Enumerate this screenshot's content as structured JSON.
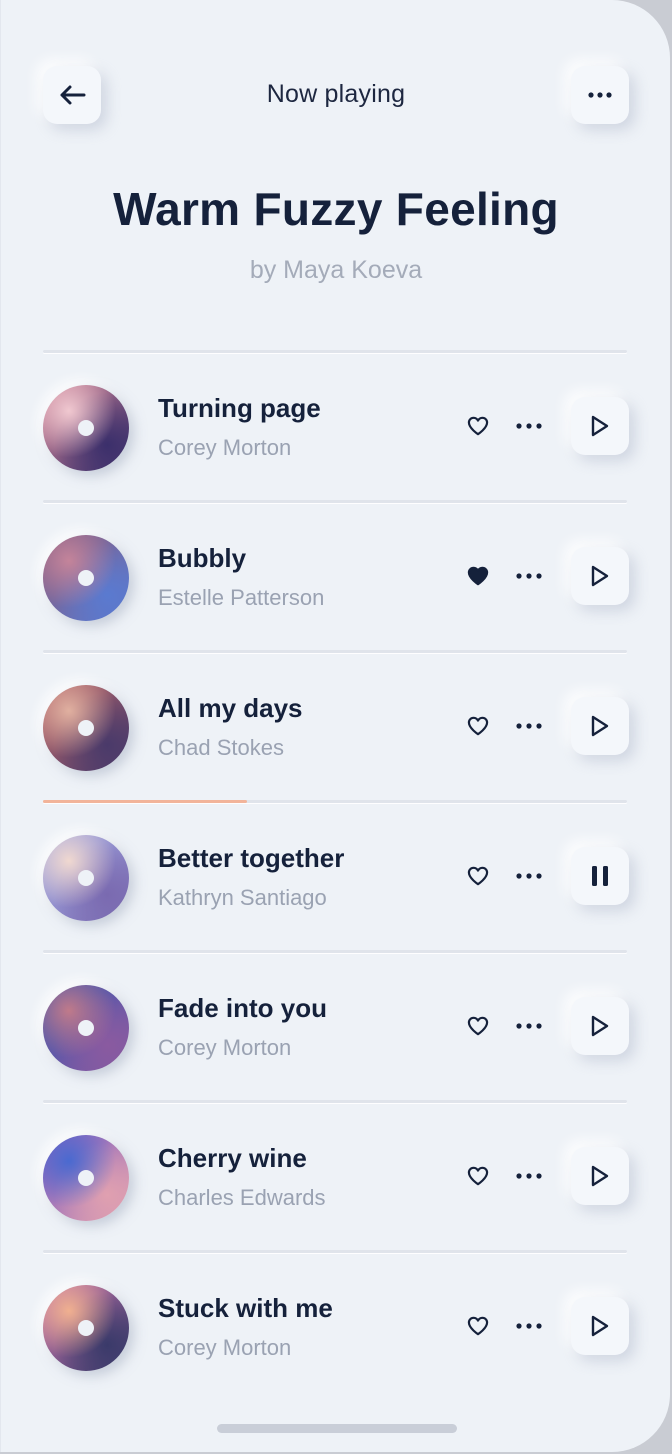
{
  "header": {
    "title": "Now playing",
    "back_icon": "arrow-left-icon",
    "more_icon": "ellipsis-icon"
  },
  "album": {
    "title": "Warm Fuzzy Feeling",
    "artist": "by Maya Koeva"
  },
  "colors": {
    "text_primary": "#15213b",
    "text_secondary": "#9aa2b2",
    "background": "#eef2f7",
    "progress": "#f2b49a"
  },
  "playback": {
    "current_track_index": 3,
    "progress_fraction": 0.35
  },
  "tracks": [
    {
      "title": "Turning page",
      "artist": "Corey Morton",
      "liked": false,
      "state": "play",
      "cover_colors": [
        "#d98a9a",
        "#3b2f6b",
        "#f0c8d0"
      ]
    },
    {
      "title": "Bubbly",
      "artist": "Estelle Patterson",
      "liked": true,
      "state": "play",
      "cover_colors": [
        "#8a5a7a",
        "#5a7ad0",
        "#c4849a"
      ]
    },
    {
      "title": "All my days",
      "artist": "Chad Stokes",
      "liked": false,
      "state": "play",
      "cover_colors": [
        "#c06a6a",
        "#4a3a6a",
        "#e0b0a0"
      ]
    },
    {
      "title": "Better together",
      "artist": "Kathryn Santiago",
      "liked": false,
      "state": "pause",
      "cover_colors": [
        "#a8b0e8",
        "#7a6ab0",
        "#f0d8d0"
      ]
    },
    {
      "title": "Fade into you",
      "artist": "Corey Morton",
      "liked": false,
      "state": "play",
      "cover_colors": [
        "#3a56b0",
        "#8a5aa0",
        "#c07a8a"
      ]
    },
    {
      "title": "Cherry wine",
      "artist": "Charles Edwards",
      "liked": false,
      "state": "play",
      "cover_colors": [
        "#7a5ac0",
        "#e0a0b0",
        "#4a6ad0"
      ]
    },
    {
      "title": "Stuck with me",
      "artist": "Corey Morton",
      "liked": false,
      "state": "play",
      "cover_colors": [
        "#d07ab0",
        "#3a3a6a",
        "#f0b090"
      ]
    }
  ]
}
